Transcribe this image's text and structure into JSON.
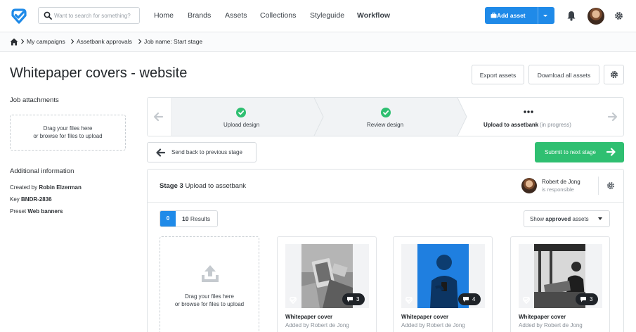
{
  "search": {
    "placeholder": "Want to search for something?"
  },
  "nav": {
    "home": "Home",
    "brands": "Brands",
    "assets": "Assets",
    "collections": "Collections",
    "styleguide": "Styleguide",
    "workflow": "Workflow"
  },
  "header": {
    "add_asset": "Add asset"
  },
  "breadcrumb": {
    "items": [
      "My campaigns",
      "Assetbank approvals",
      "Job name: Start stage"
    ]
  },
  "page": {
    "title": "Whitepaper covers - website",
    "export_assets": "Export assets",
    "download_all": "Download all assets"
  },
  "attachments": {
    "title": "Job attachments",
    "drop_line1": "Drag your files here",
    "drop_line2": "or browse for files to upload"
  },
  "info": {
    "title": "Additional information",
    "created_label": "Created by",
    "created_value": "Robin Elzerman",
    "key_label": "Key",
    "key_value": "BNDR-2836",
    "preset_label": "Preset",
    "preset_value": "Web banners"
  },
  "stages": [
    {
      "label": "Upload design",
      "state": "done"
    },
    {
      "label": "Review design",
      "state": "done"
    },
    {
      "label": "Upload to assetbank",
      "status": "(in progress)",
      "state": "current"
    }
  ],
  "actions": {
    "back": "Send back to previous stage",
    "submit": "Submit to next stage"
  },
  "panel": {
    "stage_label": "Stage 3",
    "stage_name": "Upload to assetbank",
    "responsible_name": "Robert de Jong",
    "responsible_role": "is responsible",
    "count": "0",
    "results_count": "10",
    "results_label": "Results",
    "filter_prefix": "Show",
    "filter_bold": "approved",
    "filter_suffix": "assets",
    "upload_line1": "Drag your files here",
    "upload_line2": "or browse for files to upload"
  },
  "assets": [
    {
      "title": "Whitepaper cover",
      "added_by": "Added by Robert de Jong",
      "comments": "3"
    },
    {
      "title": "Whitepaper cover",
      "added_by": "Added by Robert de Jong",
      "comments": "4"
    },
    {
      "title": "Whitepaper cover",
      "added_by": "Added by Robert de Jong",
      "comments": "3"
    }
  ],
  "colors": {
    "brand_blue": "#1f8ae8",
    "success_green": "#2fbf71",
    "dark": "#1f2328"
  }
}
